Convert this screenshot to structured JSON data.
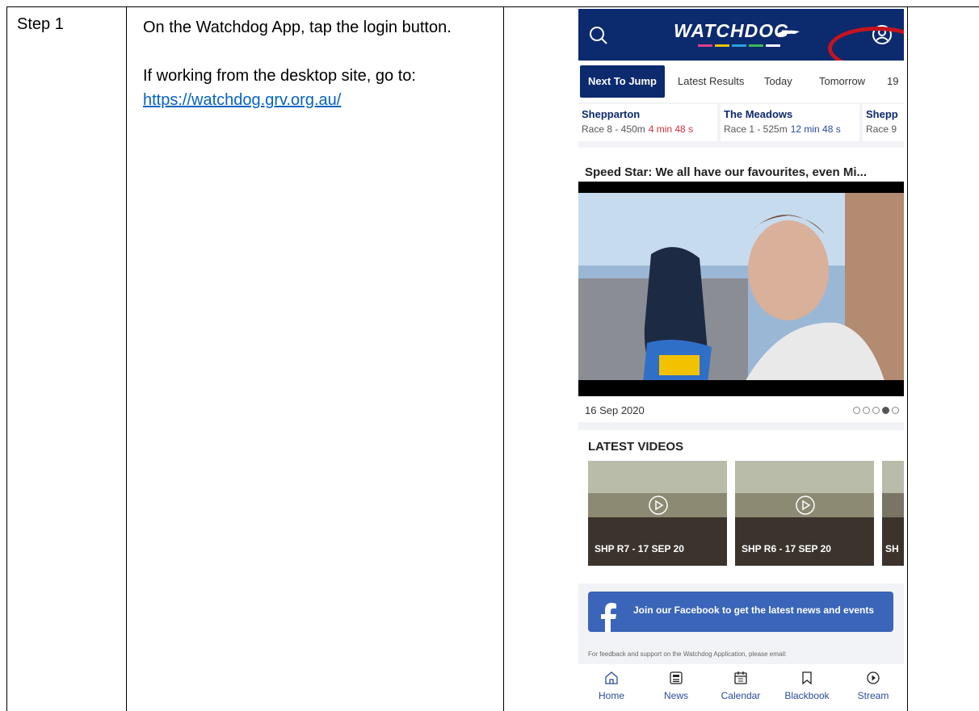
{
  "doc": {
    "step_label": "Step 1",
    "instruction_line1": "On the Watchdog App, tap the login button.",
    "instruction_line2_prefix": "If working from the desktop site, go to: ",
    "link_text": "https://watchdog.grv.org.au/"
  },
  "app": {
    "logo_text": "WATCHDOG",
    "tabs": [
      "Next To Jump",
      "Latest Results",
      "Today",
      "Tomorrow",
      "19"
    ],
    "races": [
      {
        "track": "Shepparton",
        "info": "Race 8 - 450m",
        "time": "4 min 48 s"
      },
      {
        "track": "The Meadows",
        "info": "Race 1 - 525m",
        "time": "12 min 48 s"
      },
      {
        "track": "Shepp",
        "info": "Race 9",
        "time": ""
      }
    ],
    "news": {
      "title": "Speed Star: We all have our favourites, even Mi...",
      "date": "16 Sep 2020"
    },
    "videos": {
      "title": "LATEST VIDEOS",
      "items": [
        "SHP R7 - 17 SEP 20",
        "SHP R6 - 17 SEP 20",
        "SH"
      ]
    },
    "facebook_text": "Join our Facebook to get the latest news and events",
    "feedback_text": "For feedback and support on the Watchdog Application, please email:",
    "nav": [
      "Home",
      "News",
      "Calendar",
      "Blackbook",
      "Stream"
    ]
  },
  "colors": {
    "header": "#0c2a6e",
    "highlight_ring": "#c4141f",
    "link": "#0563c1",
    "facebook": "#3a65b8"
  }
}
